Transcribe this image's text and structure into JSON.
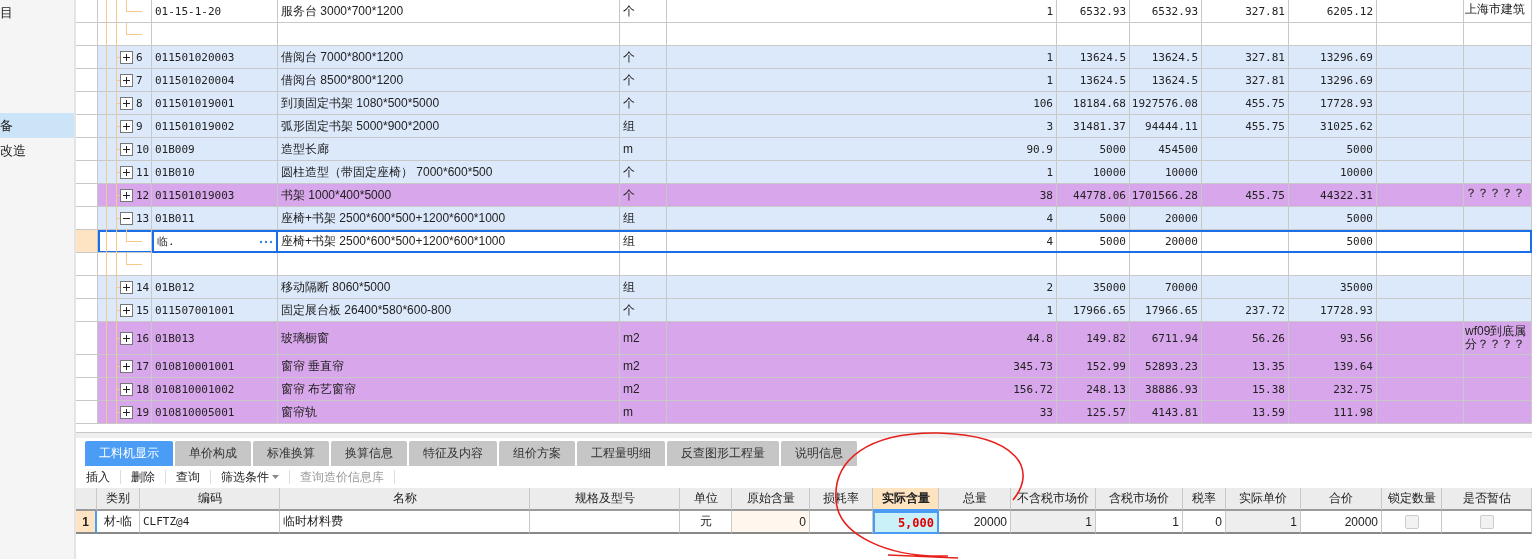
{
  "sidebar": {
    "items": [
      {
        "label": "目",
        "selected": false
      },
      {
        "label": "备",
        "selected": true
      },
      {
        "label": "改造",
        "selected": false
      }
    ]
  },
  "grid": {
    "rows": [
      {
        "kind": "sub",
        "selected": false,
        "color": "#ffffff",
        "code": "01-15-1-20",
        "name": "服务台 3000*700*1200",
        "unit": "个",
        "values": {
          "column_6": "1",
          "column_7": "6532.93",
          "column_8": "6532.93",
          "column_9": "327.81",
          "column_10": "6205.12",
          "column_12": "上海市建筑"
        }
      },
      {
        "kind": "end",
        "selected": false,
        "color": "#ffffff"
      },
      {
        "kind": "item",
        "selected": false,
        "expanded": false,
        "color": "#dce9fb",
        "no": "6",
        "code": "011501020003",
        "name": "借阅台 7000*800*1200",
        "unit": "个",
        "values": {
          "column_6": "1",
          "column_7": "13624.5",
          "column_8": "13624.5",
          "column_9": "327.81",
          "column_10": "13296.69"
        }
      },
      {
        "kind": "item",
        "selected": false,
        "expanded": false,
        "color": "#dce9fb",
        "no": "7",
        "code": "011501020004",
        "name": "借阅台 8500*800*1200",
        "unit": "个",
        "values": {
          "column_6": "1",
          "column_7": "13624.5",
          "column_8": "13624.5",
          "column_9": "327.81",
          "column_10": "13296.69"
        }
      },
      {
        "kind": "item",
        "selected": false,
        "expanded": false,
        "color": "#dce9fb",
        "no": "8",
        "code": "011501019001",
        "name": "到顶固定书架 1080*500*5000",
        "unit": "个",
        "values": {
          "column_6": "106",
          "column_7": "18184.68",
          "column_8": "1927576.08",
          "column_9": "455.75",
          "column_10": "17728.93"
        }
      },
      {
        "kind": "item",
        "selected": false,
        "expanded": false,
        "color": "#dce9fb",
        "no": "9",
        "code": "011501019002",
        "name": "弧形固定书架 5000*900*2000",
        "unit": "组",
        "values": {
          "column_6": "3",
          "column_7": "31481.37",
          "column_8": "94444.11",
          "column_9": "455.75",
          "column_10": "31025.62"
        }
      },
      {
        "kind": "item",
        "selected": false,
        "expanded": false,
        "color": "#dce9fb",
        "no": "10",
        "code": "01B009",
        "name": "造型长廊",
        "unit": "m",
        "values": {
          "column_6": "90.9",
          "column_7": "5000",
          "column_8": "454500",
          "column_10": "5000"
        }
      },
      {
        "kind": "item",
        "selected": false,
        "expanded": false,
        "color": "#dce9fb",
        "no": "11",
        "code": "01B010",
        "name": "圆柱造型（带固定座椅） 7000*600*500",
        "unit": "个",
        "values": {
          "column_6": "1",
          "column_7": "10000",
          "column_8": "10000",
          "column_10": "10000"
        }
      },
      {
        "kind": "item",
        "selected": false,
        "expanded": false,
        "color": "#d8a6ea",
        "no": "12",
        "code": "011501019003",
        "name": "书架 1000*400*5000",
        "unit": "个",
        "values": {
          "column_6": "38",
          "column_7": "44778.06",
          "column_8": "1701566.28",
          "column_9": "455.75",
          "column_10": "44322.31",
          "column_12": "？？？？？"
        }
      },
      {
        "kind": "item",
        "selected": false,
        "expanded": true,
        "color": "#dce9fb",
        "no": "13",
        "code": "01B011",
        "name": "座椅+书架 2500*600*500+1200*600*1000",
        "unit": "组",
        "values": {
          "column_6": "4",
          "column_7": "5000",
          "column_8": "20000",
          "column_10": "5000"
        }
      },
      {
        "kind": "sub",
        "selected": true,
        "color": "#ffffff",
        "code": "临.",
        "name": "座椅+书架 2500*600*500+1200*600*1000",
        "unit": "组",
        "values": {
          "column_6": "4",
          "column_7": "5000",
          "column_8": "20000",
          "column_10": "5000"
        }
      },
      {
        "kind": "end",
        "selected": false,
        "color": "#ffffff"
      },
      {
        "kind": "item",
        "selected": false,
        "expanded": false,
        "color": "#dce9fb",
        "no": "14",
        "code": "01B012",
        "name": "移动隔断 8060*5000",
        "unit": "组",
        "values": {
          "column_6": "2",
          "column_7": "35000",
          "column_8": "70000",
          "column_10": "35000"
        }
      },
      {
        "kind": "item",
        "selected": false,
        "expanded": false,
        "color": "#dce9fb",
        "no": "15",
        "code": "011507001001",
        "name": "固定展台板 26400*580*600-800",
        "unit": "个",
        "values": {
          "column_6": "1",
          "column_7": "17966.65",
          "column_8": "17966.65",
          "column_9": "237.72",
          "column_10": "17728.93"
        }
      },
      {
        "kind": "item",
        "selected": false,
        "expanded": false,
        "color": "#d8a6ea",
        "no": "16",
        "code": "01B013",
        "name": "玻璃橱窗",
        "unit": "m2",
        "values": {
          "column_6": "44.8",
          "column_7": "149.82",
          "column_8": "6711.94",
          "column_9": "56.26",
          "column_10": "93.56",
          "column_12": "wf09到底属分？？？？"
        }
      },
      {
        "kind": "item",
        "selected": false,
        "expanded": false,
        "color": "#d8a6ea",
        "no": "17",
        "code": "010810001001",
        "name": "窗帘 垂直帘",
        "unit": "m2",
        "values": {
          "column_6": "345.73",
          "column_7": "152.99",
          "column_8": "52893.23",
          "column_9": "13.35",
          "column_10": "139.64"
        }
      },
      {
        "kind": "item",
        "selected": false,
        "expanded": false,
        "color": "#d8a6ea",
        "no": "18",
        "code": "010810001002",
        "name": "窗帘 布艺窗帘",
        "unit": "m2",
        "values": {
          "column_6": "156.72",
          "column_7": "248.13",
          "column_8": "38886.93",
          "column_9": "15.38",
          "column_10": "232.75"
        }
      },
      {
        "kind": "item",
        "selected": false,
        "expanded": false,
        "color": "#d8a6ea",
        "no": "19",
        "code": "010810005001",
        "name": "窗帘轨",
        "unit": "m",
        "values": {
          "column_6": "33",
          "column_7": "125.57",
          "column_8": "4143.81",
          "column_9": "13.59",
          "column_10": "111.98"
        }
      }
    ]
  },
  "tabs": [
    {
      "label": "工料机显示",
      "selected": true
    },
    {
      "label": "单价构成",
      "selected": false
    },
    {
      "label": "标准换算",
      "selected": false
    },
    {
      "label": "换算信息",
      "selected": false
    },
    {
      "label": "特征及内容",
      "selected": false
    },
    {
      "label": "组价方案",
      "selected": false
    },
    {
      "label": "工程量明细",
      "selected": false
    },
    {
      "label": "反查图形工程量",
      "selected": false
    },
    {
      "label": "说明信息",
      "selected": false
    }
  ],
  "toolbar": [
    {
      "label": "插入",
      "disabled": false,
      "dropdown": false
    },
    {
      "label": "删除",
      "disabled": false,
      "dropdown": false
    },
    {
      "label": "查询",
      "disabled": false,
      "dropdown": false
    },
    {
      "label": "筛选条件",
      "disabled": false,
      "dropdown": true
    },
    {
      "label": "查询造价信息库",
      "disabled": true,
      "dropdown": false
    }
  ],
  "detail_table": {
    "columns": [
      {
        "label": "类别",
        "selected": false
      },
      {
        "label": "编码",
        "selected": false
      },
      {
        "label": "名称",
        "selected": false
      },
      {
        "label": "规格及型号",
        "selected": false
      },
      {
        "label": "单位",
        "selected": false
      },
      {
        "label": "原始含量",
        "selected": false
      },
      {
        "label": "损耗率",
        "selected": false
      },
      {
        "label": "实际含量",
        "selected": true
      },
      {
        "label": "总量",
        "selected": false
      },
      {
        "label": "不含税市场价",
        "selected": false
      },
      {
        "label": "含税市场价",
        "selected": false
      },
      {
        "label": "税率",
        "selected": false
      },
      {
        "label": "实际单价",
        "selected": false
      },
      {
        "label": "合价",
        "selected": false
      },
      {
        "label": "锁定数量",
        "selected": false
      },
      {
        "label": "是否暂估",
        "selected": false
      }
    ],
    "rows": [
      {
        "no": "1",
        "cells": {
          "类别": "材-临",
          "编码": "CLFTZ@4",
          "名称": "临时材料费",
          "单位": "元",
          "原始含量": "0",
          "实际含量": "5,000",
          "总量": "20000",
          "不含税市场价": "1",
          "含税市场价": "1",
          "税率": "0",
          "实际单价": "1",
          "合价": "20000"
        },
        "locked": false,
        "estimated": false
      }
    ]
  }
}
